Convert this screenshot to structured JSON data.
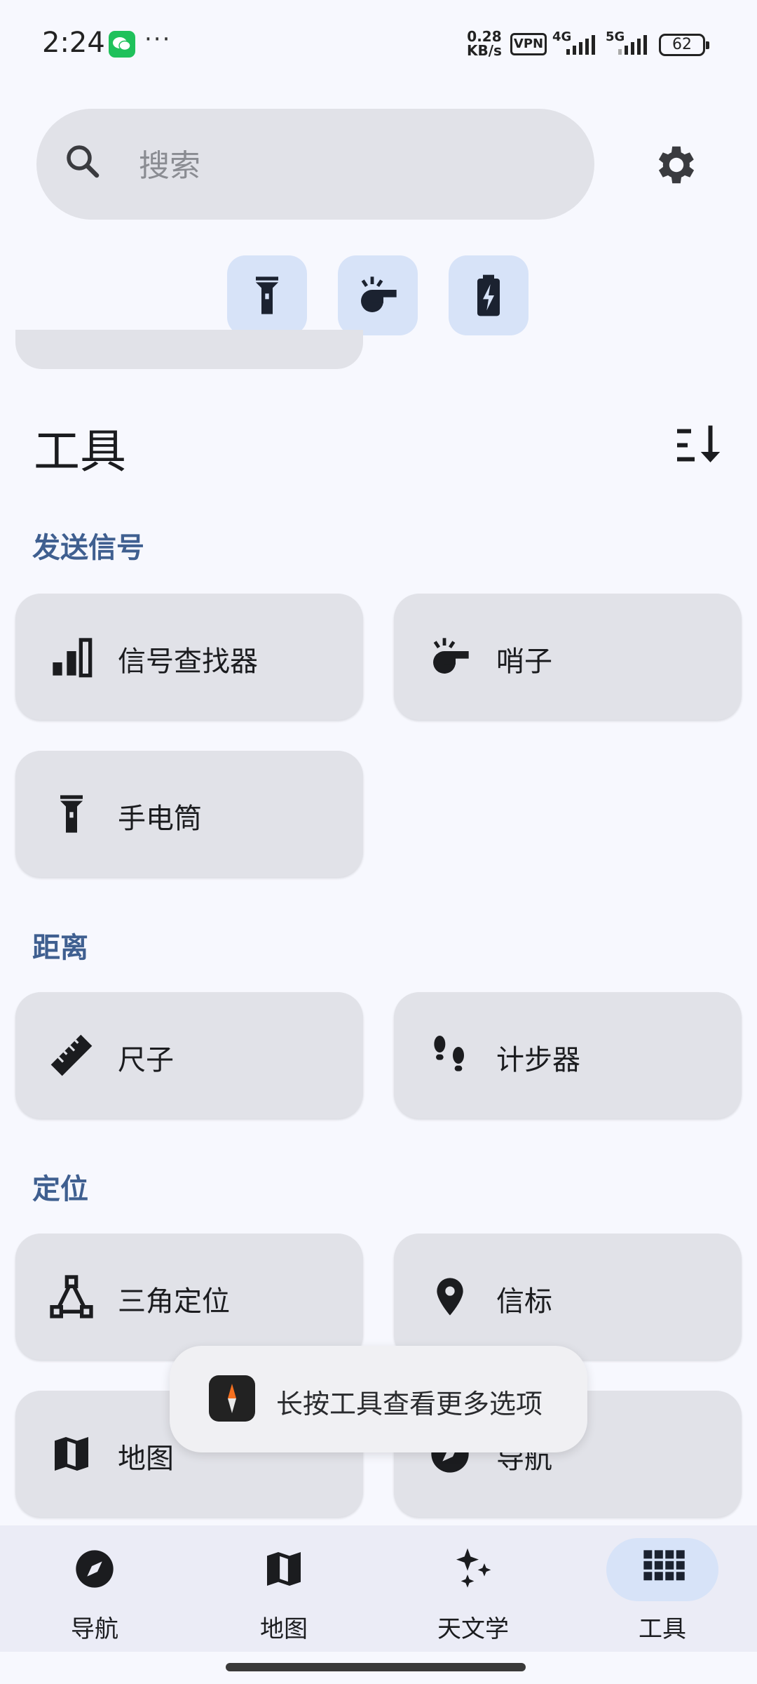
{
  "status_bar": {
    "time": "2:24",
    "dots": "···",
    "speed_value": "0.28",
    "speed_unit": "KB/s",
    "vpn": "VPN",
    "net1": "4G",
    "net2": "5G",
    "battery": "62"
  },
  "search": {
    "placeholder": "搜索"
  },
  "quick_actions": [
    "flashlight-icon",
    "whistle-icon",
    "battery-bolt-icon"
  ],
  "header": {
    "title": "工具"
  },
  "sections": [
    {
      "label": "发送信号",
      "tools": [
        "信号查找器",
        "哨子",
        "手电筒"
      ]
    },
    {
      "label": "距离",
      "tools": [
        "尺子",
        "计步器"
      ]
    },
    {
      "label": "定位",
      "tools": [
        "三角定位",
        "信标",
        "地图",
        "导航"
      ]
    }
  ],
  "toast": {
    "text": "长按工具查看更多选项"
  },
  "bottom_nav": {
    "items": [
      {
        "label": "导航",
        "icon": "compass-icon"
      },
      {
        "label": "地图",
        "icon": "map-icon"
      },
      {
        "label": "天文学",
        "icon": "sparkle-icon"
      },
      {
        "label": "工具",
        "icon": "grid-icon",
        "active": true
      }
    ]
  },
  "colors": {
    "accent": "#3f5f90",
    "card": "#e1e2e8",
    "chip": "#d7e3f8",
    "background": "#f7f8fe"
  }
}
